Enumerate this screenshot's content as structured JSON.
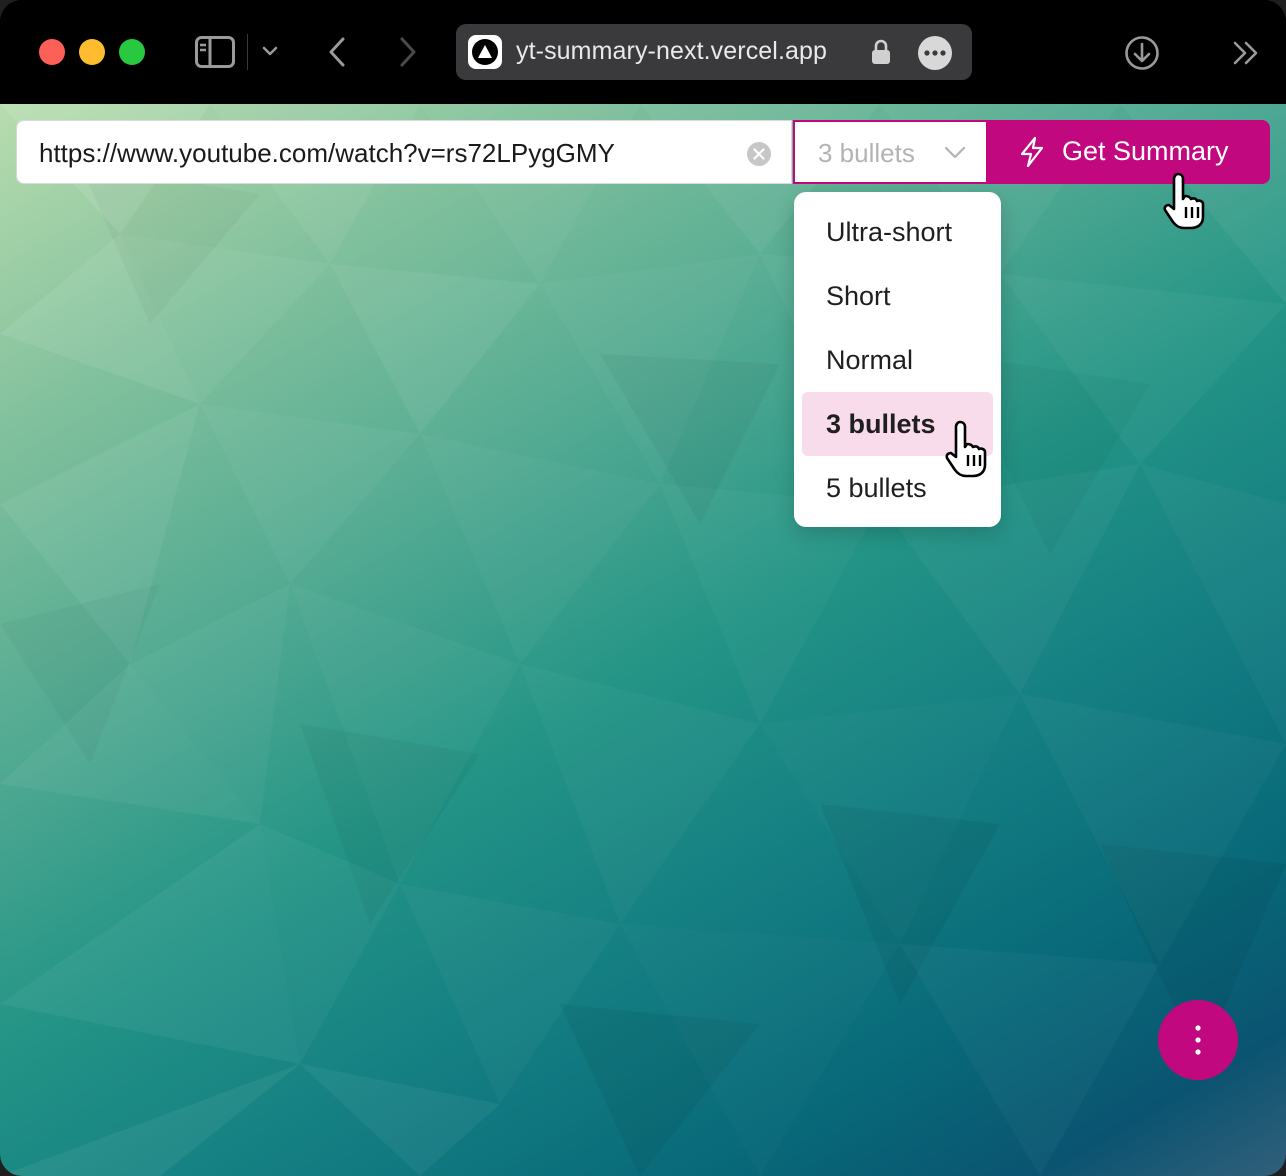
{
  "browser": {
    "address_text": "yt-summary-next.vercel.app",
    "favicon": "vercel-triangle-icon"
  },
  "form": {
    "url_value": "https://www.youtube.com/watch?v=rs72LPygGMY",
    "format_selected": "3 bullets",
    "submit_label": "Get Summary"
  },
  "dropdown": {
    "options": [
      "Ultra-short",
      "Short",
      "Normal",
      "3 bullets",
      "5 bullets"
    ],
    "highlighted": "3 bullets"
  },
  "colors": {
    "accent": "#c2087f",
    "highlight": "#f8dcec"
  }
}
